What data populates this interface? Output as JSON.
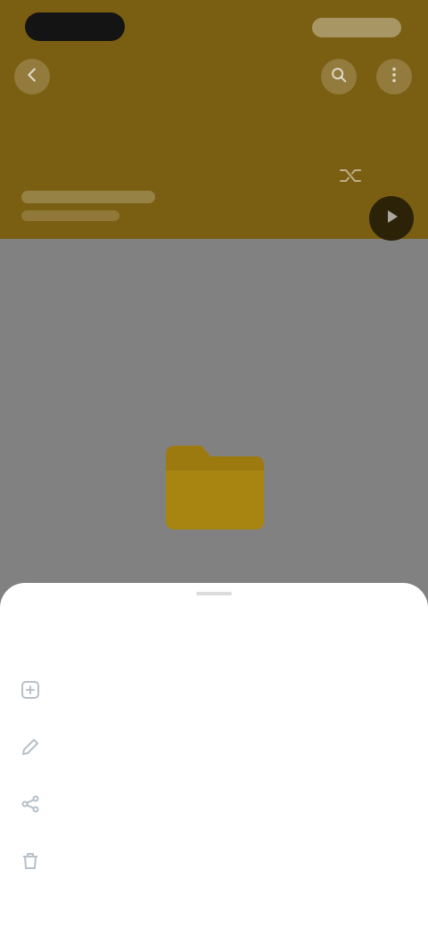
{
  "status_bar": {
    "time": "",
    "icons": [
      "signal-icon",
      "wifi-icon",
      "battery-icon"
    ]
  },
  "header": {
    "title": "",
    "subtitle": "",
    "background_color": "#7a5f12",
    "buttons": [
      "back-icon",
      "search-icon",
      "more-icon",
      "shuffle-icon",
      "play-icon"
    ]
  },
  "content": {
    "empty_state_icon": "folder-icon",
    "background_color": "#818181",
    "accent_color": "#9c7a10"
  },
  "sheet": {
    "title": "",
    "items": [
      {
        "label": "",
        "icon": "add-icon"
      },
      {
        "label": "",
        "icon": "edit-icon"
      },
      {
        "label": "",
        "icon": "share-icon"
      },
      {
        "label": "",
        "icon": "delete-icon"
      }
    ]
  }
}
